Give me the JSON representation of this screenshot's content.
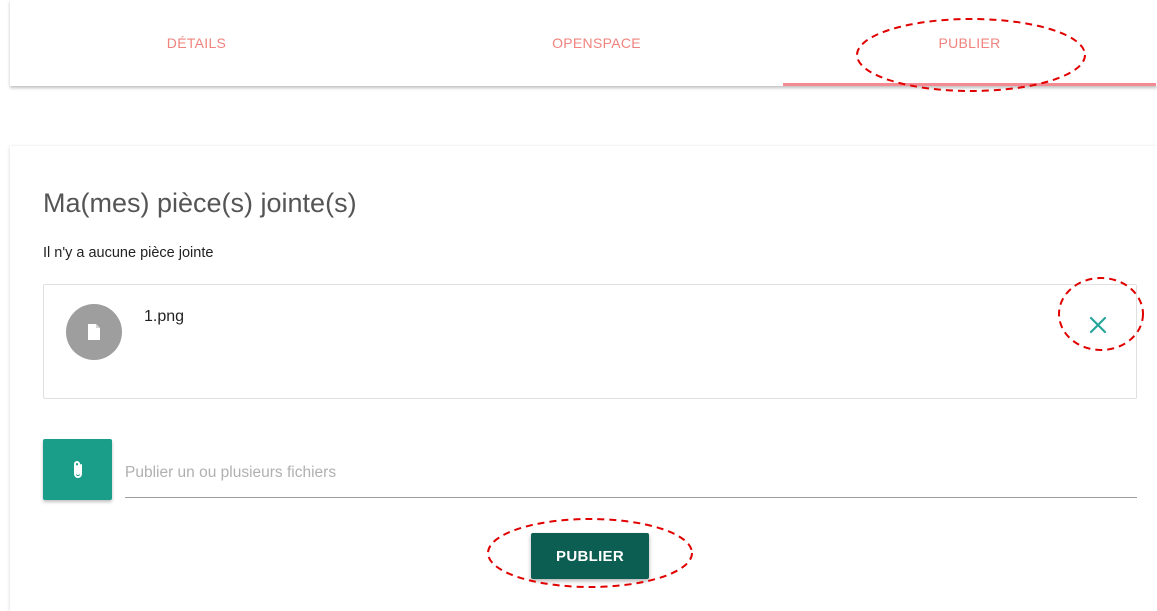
{
  "tabs": [
    {
      "label": "DÉTAILS",
      "active": false
    },
    {
      "label": "OPENSPACE",
      "active": false
    },
    {
      "label": "PUBLIER",
      "active": true
    }
  ],
  "card": {
    "title": "Ma(mes) pièce(s) jointe(s)",
    "subtitle": "Il n'y a aucune pièce jointe",
    "file": {
      "name": "1.png",
      "avatar_icon": "file-icon",
      "remove_icon": "close-icon"
    },
    "upload": {
      "button_icon": "paperclip-icon",
      "placeholder": "Publier un ou plusieurs fichiers",
      "value": ""
    },
    "publish_label": "PUBLIER"
  },
  "colors": {
    "tab_text": "#f0837e",
    "tab_indicator": "#f48b93",
    "attach_button": "#1a9e8a",
    "publish_button": "#0c5e52",
    "remove_icon": "#26a69a",
    "annotation": "#e00000"
  }
}
